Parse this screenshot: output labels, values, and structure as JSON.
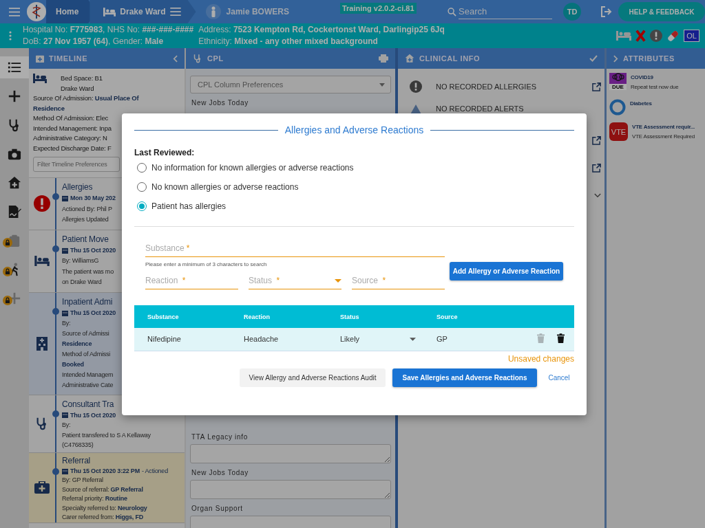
{
  "top_bar": {
    "breadcrumbs": [
      {
        "label": "Home"
      },
      {
        "label": "Drake Ward"
      }
    ],
    "patient_name": "Jamie BOWERS",
    "environment": "Training v2.0.2-ci.81",
    "search": {
      "placeholder": "Search"
    },
    "user_initials": "TD",
    "help_button": "HELP & FEEDBACK"
  },
  "patient_banner": {
    "left_lines": [
      "Hospital No: **F775983**, NHS No: **###-###-####**",
      "DoB: **27 Nov 1957 (64)**, Gender: **Male**"
    ],
    "right_lines": [
      "Address: **7523 Kempton Rd, Cockertonst Ward, Darlingip25 6Jq**",
      "Ethnicity: **Mixed - any other mixed background**"
    ],
    "badge": "OL"
  },
  "sidebar": {
    "items": [
      {
        "selected": true,
        "locked": false
      },
      {
        "selected": false,
        "locked": false
      },
      {
        "selected": false,
        "locked": false
      },
      {
        "selected": false,
        "locked": false
      },
      {
        "selected": false,
        "locked": false
      },
      {
        "selected": false,
        "locked": false
      },
      {
        "selected": false,
        "locked": true
      },
      {
        "selected": false,
        "locked": true
      },
      {
        "selected": false,
        "locked": true
      }
    ]
  },
  "timeline": {
    "header": "TIMELINE",
    "bed_space": "Bed Space: B1",
    "ward": "Drake Ward",
    "summary": [
      "Source Of Admission: **Usual Place Of Residence**",
      "Method Of Admission: Elec",
      "Intended Management: Inpa",
      "Administrative Category: N",
      "Expected Discharge Date: F"
    ],
    "filter": {
      "placeholder": "Filter Timeline Preferences"
    },
    "entries": [
      {
        "kind": "allergy",
        "title": "Allergies",
        "date": "Mon 30 May 202",
        "details": [
          "Actioned By: Phil P",
          "Allergies Updated"
        ]
      },
      {
        "kind": "move",
        "title": "Patient Move",
        "date": "Thu 15 Oct 2020",
        "details": [
          "By: WilliamsG",
          "The patient was mo",
          "on Drake Ward"
        ]
      },
      {
        "kind": "admission",
        "title": "Inpatient Admi",
        "date": "Thu 15 Oct 2020",
        "details": [
          "By:",
          "Source of Admissi",
          "**Residence**",
          "Method of Admissi",
          "**Booked**",
          "Intended Managem",
          "Administrative Cate"
        ]
      },
      {
        "kind": "consultant",
        "title": "Consultant Tra",
        "date": "Thu 15 Oct 2020",
        "details": [
          "By:",
          "Patient transfered to S A Kellaway",
          "(C4768335)"
        ]
      },
      {
        "kind": "referral",
        "title": "Referral",
        "date": "Thu 15 Oct 2020 3:22 PM",
        "status": "- Actioned",
        "details": [
          "By: GP Referral",
          "Source of referral: **GP Referral**",
          "Referral priority: **Routine**",
          "Specialty referred to: **Neurology**",
          "Carer referred from: **Higgs, FD**"
        ]
      }
    ]
  },
  "cpl": {
    "header": "CPL",
    "select": "CPL Column Preferences",
    "top_sections": [
      "New Jobs Today"
    ],
    "bottom_sections": [
      "TTA Legacy info",
      "New Jobs Today",
      "Organ Support"
    ]
  },
  "clinical_info": {
    "header": "CLINICAL INFO",
    "rows": [
      {
        "kind": "allergies",
        "text": "NO RECORDED ALLERGIES",
        "link": true
      },
      {
        "kind": "alerts",
        "text": "NO RECORDED ALERTS",
        "link": false
      },
      {
        "kind": "hidden",
        "link": true
      },
      {
        "kind": "hidden",
        "link": true
      },
      {
        "kind": "expand"
      }
    ]
  },
  "attributes": {
    "header": "ATTRIBUTES",
    "items": [
      {
        "kind": "due",
        "badge": "DUE",
        "title": "COVID19",
        "subtitle": "Repeat test now due"
      },
      {
        "kind": "ring",
        "title": "Diabetes"
      },
      {
        "kind": "vte",
        "badge": "VTE",
        "title": "VTE Assessment requir...",
        "subtitle": "VTE Assessment Required"
      }
    ]
  },
  "modal": {
    "title": "Allergies and Adverse Reactions",
    "last_reviewed_label": "Last Reviewed:",
    "options": [
      {
        "label": "No information for known allergies or adverse reactions",
        "selected": false
      },
      {
        "label": "No known allergies or adverse reactions",
        "selected": false
      },
      {
        "label": "Patient has allergies",
        "selected": true
      }
    ],
    "substance": {
      "placeholder": "Substance",
      "required_mark": "*",
      "hint": "Please enter a minimum of 3 characters to search"
    },
    "fields": [
      {
        "kind": "text",
        "placeholder": "Reaction",
        "required_mark": "*"
      },
      {
        "kind": "select",
        "placeholder": "Status",
        "required_mark": "*"
      },
      {
        "kind": "text",
        "placeholder": "Source",
        "required_mark": "*"
      }
    ],
    "add_button": "Add Allergy or Adverse Reaction",
    "table": {
      "columns": [
        "Substance",
        "Reaction",
        "Status",
        "Source"
      ],
      "rows": [
        {
          "substance": "Nifedipine",
          "reaction": "Headache",
          "status": "Likely",
          "source": "GP",
          "actions": [
            {
              "disabled": true
            },
            {
              "disabled": false
            }
          ]
        }
      ]
    },
    "unsaved_note": "Unsaved changes",
    "buttons": [
      {
        "kind": "secondary",
        "label": "View Allergy and Adverse Reactions Audit"
      },
      {
        "kind": "primary",
        "label": "Save Allergies and Adverse Reactions"
      },
      {
        "kind": "link",
        "label": "Cancel"
      }
    ]
  }
}
